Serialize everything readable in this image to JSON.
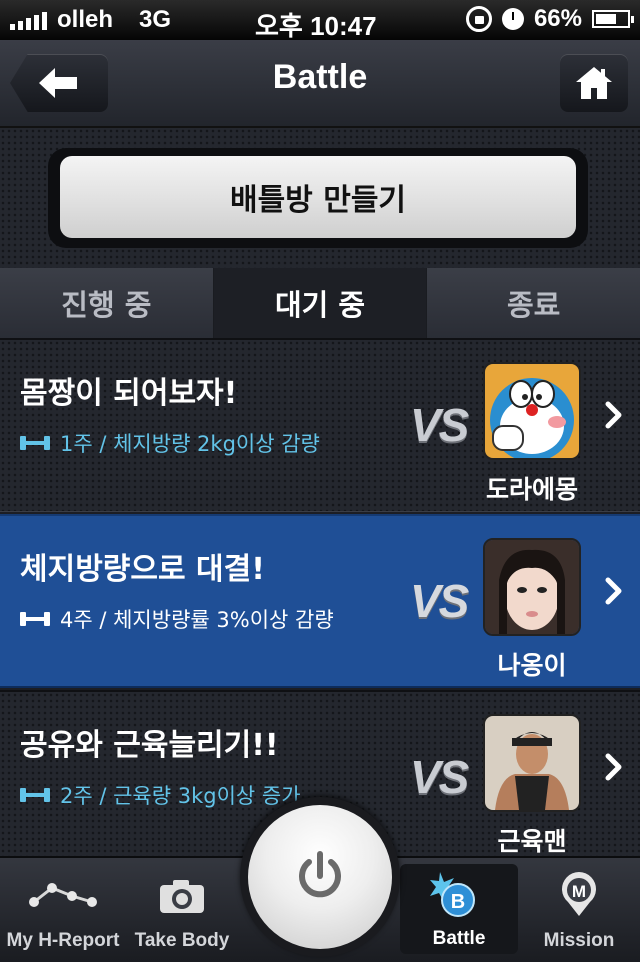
{
  "status_bar": {
    "carrier": "olleh",
    "network": "3G",
    "time": "오후 10:47",
    "battery": "66%",
    "battery_level": 0.66
  },
  "header": {
    "title": "Battle",
    "back_icon": "arrow-left-icon",
    "home_icon": "home-icon"
  },
  "create_button": {
    "label": "배틀방 만들기"
  },
  "tabs": [
    {
      "label": "진행 중",
      "active": false
    },
    {
      "label": "대기 중",
      "active": true
    },
    {
      "label": "종료",
      "active": false
    }
  ],
  "battles": [
    {
      "title": "몸짱이 되어보자!",
      "goal": "1주 / 체지방량 2kg이상 감량",
      "vs": "VS",
      "opponent": "도라에몽",
      "selected": false
    },
    {
      "title": "체지방량으로 대결!",
      "goal": "4주 / 체지방량률 3%이상 감량",
      "vs": "VS",
      "opponent": "나옹이",
      "selected": true
    },
    {
      "title": "공유와 근육늘리기!!",
      "goal": "2주 / 근육량 3kg이상 증가",
      "vs": "VS",
      "opponent": "근육맨",
      "selected": false
    }
  ],
  "tabbar": {
    "items": [
      {
        "label": "My H-Report",
        "icon": "graph-icon"
      },
      {
        "label": "Take Body",
        "icon": "camera-icon"
      },
      {
        "label": "Battle",
        "icon": "battle-badge-icon",
        "active": true
      },
      {
        "label": "Mission",
        "icon": "mission-pin-icon"
      }
    ],
    "center_icon": "power-icon"
  },
  "colors": {
    "selected_row": "#1f4f96",
    "goal_text": "#62c3e8",
    "background": "#24272e"
  }
}
